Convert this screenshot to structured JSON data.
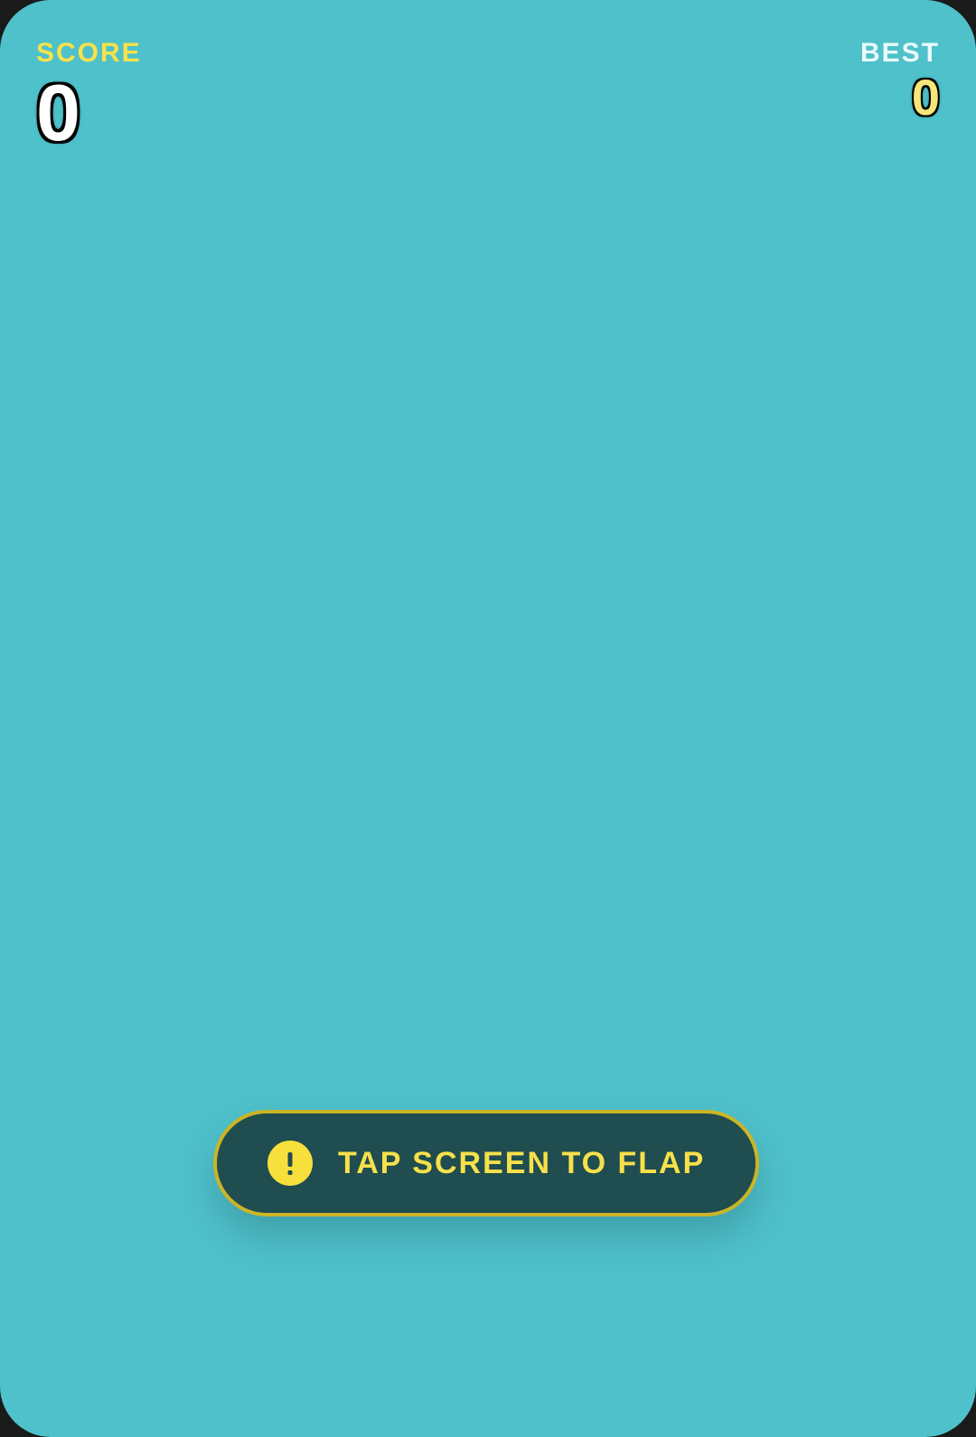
{
  "hud": {
    "score_label": "SCORE",
    "score_value": "0",
    "best_label": "BEST",
    "best_value": "0"
  },
  "hint": {
    "icon": "alert-icon",
    "text": "TAP SCREEN TO FLAP"
  },
  "colors": {
    "sky": "#4fc1cb",
    "accent_yellow": "#f7e04a",
    "pill_background": "#204d4f",
    "pill_border": "#cbb527"
  }
}
